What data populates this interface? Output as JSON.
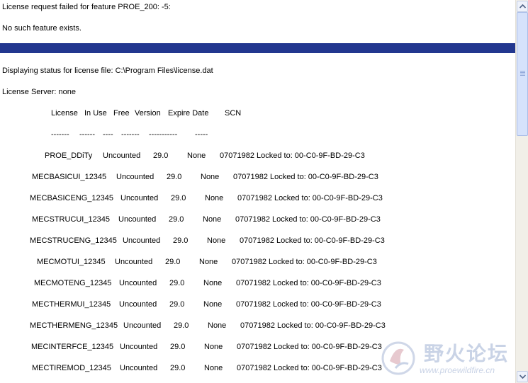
{
  "header": {
    "error_line": "License request failed for feature PROE_200: -5:",
    "error_detail": "No such feature exists.",
    "status_line": "Displaying status for license file: C:\\Program Files\\license.dat",
    "server_line": "License Server: none"
  },
  "table": {
    "columns": [
      "License",
      "In Use",
      "Free",
      "Version",
      "Expire Date",
      "SCN"
    ],
    "separators": [
      "-------",
      "------",
      "----",
      "-------",
      "-----------",
      "-----"
    ],
    "rows": [
      {
        "license": "PROE_DDiTy",
        "in_use": "Uncounted",
        "version": "29.0",
        "expire": "None",
        "scn": "07071982 Locked to: 00-C0-9F-BD-29-C3"
      },
      {
        "license": "MECBASICUI_12345",
        "in_use": "Uncounted",
        "version": "29.0",
        "expire": "None",
        "scn": "07071982 Locked to: 00-C0-9F-BD-29-C3"
      },
      {
        "license": "MECBASICENG_12345",
        "in_use": "Uncounted",
        "version": "29.0",
        "expire": "None",
        "scn": "07071982 Locked to: 00-C0-9F-BD-29-C3"
      },
      {
        "license": "MECSTRUCUI_12345",
        "in_use": "Uncounted",
        "version": "29.0",
        "expire": "None",
        "scn": "07071982 Locked to: 00-C0-9F-BD-29-C3"
      },
      {
        "license": "MECSTRUCENG_12345",
        "in_use": "Uncounted",
        "version": "29.0",
        "expire": "None",
        "scn": "07071982 Locked to: 00-C0-9F-BD-29-C3"
      },
      {
        "license": "MECMOTUI_12345",
        "in_use": "Uncounted",
        "version": "29.0",
        "expire": "None",
        "scn": "07071982 Locked to: 00-C0-9F-BD-29-C3"
      },
      {
        "license": "MECMOTENG_12345",
        "in_use": "Uncounted",
        "version": "29.0",
        "expire": "None",
        "scn": "07071982 Locked to: 00-C0-9F-BD-29-C3"
      },
      {
        "license": "MECTHERMUI_12345",
        "in_use": "Uncounted",
        "version": "29.0",
        "expire": "None",
        "scn": "07071982 Locked to: 00-C0-9F-BD-29-C3"
      },
      {
        "license": "MECTHERMENG_12345",
        "in_use": "Uncounted",
        "version": "29.0",
        "expire": "None",
        "scn": "07071982 Locked to: 00-C0-9F-BD-29-C3"
      },
      {
        "license": "MECINTERFCE_12345",
        "in_use": "Uncounted",
        "version": "29.0",
        "expire": "None",
        "scn": "07071982 Locked to: 00-C0-9F-BD-29-C3"
      },
      {
        "license": "MECTIREMOD_12345",
        "in_use": "Uncounted",
        "version": "29.0",
        "expire": "None",
        "scn": "07071982 Locked to: 00-C0-9F-BD-29-C3"
      }
    ]
  },
  "watermark": {
    "title": "野火论坛",
    "url": "www.proewildfire.cn"
  },
  "colors": {
    "separator_bar": "#22378f",
    "scrollbar_track": "#f1efe8",
    "scrollbar_thumb": "#d6e2fb",
    "watermark": "#c9d3e6"
  },
  "icons": [
    "scroll-up-arrow-icon",
    "scroll-down-arrow-icon",
    "watermark-logo-icon"
  ]
}
